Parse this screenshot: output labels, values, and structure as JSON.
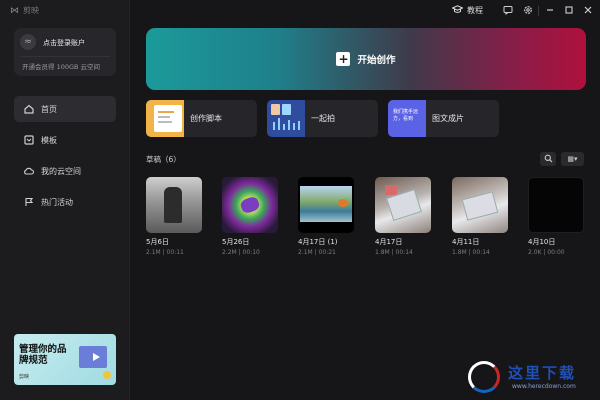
{
  "app": {
    "name": "剪映"
  },
  "titlebar": {
    "tutorial_label": "教程"
  },
  "sidebar": {
    "account": {
      "login_text": "点击登录账户",
      "vip_text": "开通会员得 100GB 云空间"
    },
    "nav": [
      {
        "label": "首页",
        "icon": "home-icon",
        "active": true
      },
      {
        "label": "模板",
        "icon": "template-icon",
        "active": false
      },
      {
        "label": "我的云空间",
        "icon": "cloud-icon",
        "active": false
      },
      {
        "label": "热门活动",
        "icon": "flag-icon",
        "active": false
      }
    ],
    "banner": {
      "text": "管理你的品牌规范",
      "tag": "剪映"
    }
  },
  "main": {
    "create_label": "开始创作",
    "tools": [
      {
        "label": "创作脚本"
      },
      {
        "label": "一起拍"
      },
      {
        "label": "图文成片",
        "thumb_text": "我们携手远方，看到"
      }
    ],
    "drafts_title": "草稿（6）",
    "drafts": [
      {
        "date": "5月6日",
        "meta": "2.1M | 00:11"
      },
      {
        "date": "5月26日",
        "meta": "2.2M | 00:10"
      },
      {
        "date": "4月17日 (1)",
        "meta": "2.1M | 00:21"
      },
      {
        "date": "4月17日",
        "meta": "1.8M | 00:14"
      },
      {
        "date": "4月11日",
        "meta": "1.8M | 00:14"
      },
      {
        "date": "4月10日",
        "meta": "2.0K | 00:00"
      }
    ]
  },
  "watermark": {
    "title": "这里下载",
    "url": "www.herecdown.com"
  }
}
